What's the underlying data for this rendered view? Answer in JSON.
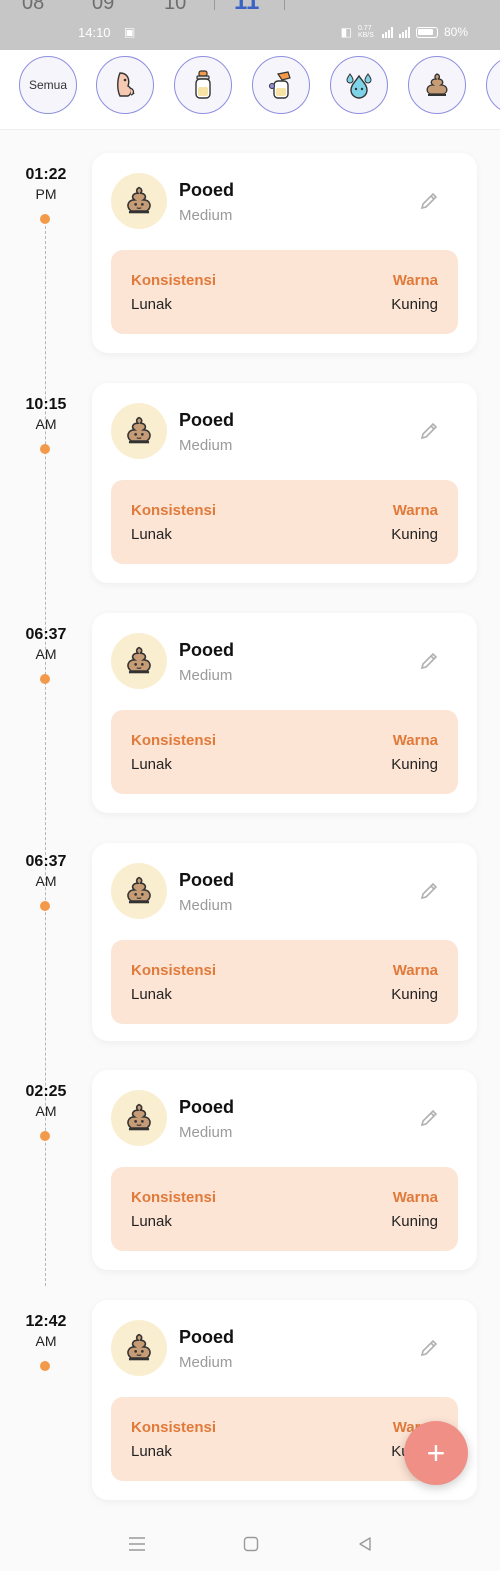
{
  "status_bar": {
    "dates": [
      "08",
      "09",
      "10",
      "11"
    ],
    "time": "14:10",
    "network": "0.77 KB/S",
    "battery": "80%"
  },
  "filters": [
    {
      "label": "Semua",
      "icon": "all-text"
    },
    {
      "label": "",
      "icon": "breastfeed-icon"
    },
    {
      "label": "",
      "icon": "bottle-icon"
    },
    {
      "label": "",
      "icon": "pump-icon"
    },
    {
      "label": "",
      "icon": "diaper-wet-icon"
    },
    {
      "label": "",
      "icon": "poop-icon"
    }
  ],
  "entries": [
    {
      "time": "01:22",
      "ampm": "PM",
      "title": "Pooed",
      "size": "Medium",
      "consistency_label": "Konsistensi",
      "consistency": "Lunak",
      "color_label": "Warna",
      "color": "Kuning"
    },
    {
      "time": "10:15",
      "ampm": "AM",
      "title": "Pooed",
      "size": "Medium",
      "consistency_label": "Konsistensi",
      "consistency": "Lunak",
      "color_label": "Warna",
      "color": "Kuning"
    },
    {
      "time": "06:37",
      "ampm": "AM",
      "title": "Pooed",
      "size": "Medium",
      "consistency_label": "Konsistensi",
      "consistency": "Lunak",
      "color_label": "Warna",
      "color": "Kuning"
    },
    {
      "time": "06:37",
      "ampm": "AM",
      "title": "Pooed",
      "size": "Medium",
      "consistency_label": "Konsistensi",
      "consistency": "Lunak",
      "color_label": "Warna",
      "color": "Kuning"
    },
    {
      "time": "02:25",
      "ampm": "AM",
      "title": "Pooed",
      "size": "Medium",
      "consistency_label": "Konsistensi",
      "consistency": "Lunak",
      "color_label": "Warna",
      "color": "Kuning"
    },
    {
      "time": "12:42",
      "ampm": "AM",
      "title": "Pooed",
      "size": "Medium",
      "consistency_label": "Konsistensi",
      "consistency": "Lunak",
      "color_label": "Warna",
      "color": "Kuning"
    }
  ],
  "fab": {
    "label": "+"
  },
  "colors": {
    "accent": "#f39a4a",
    "detail_bg": "#fde5d6",
    "label": "#e07a3a",
    "fab": "#f08f85",
    "chip_border": "#8e8ee0"
  }
}
